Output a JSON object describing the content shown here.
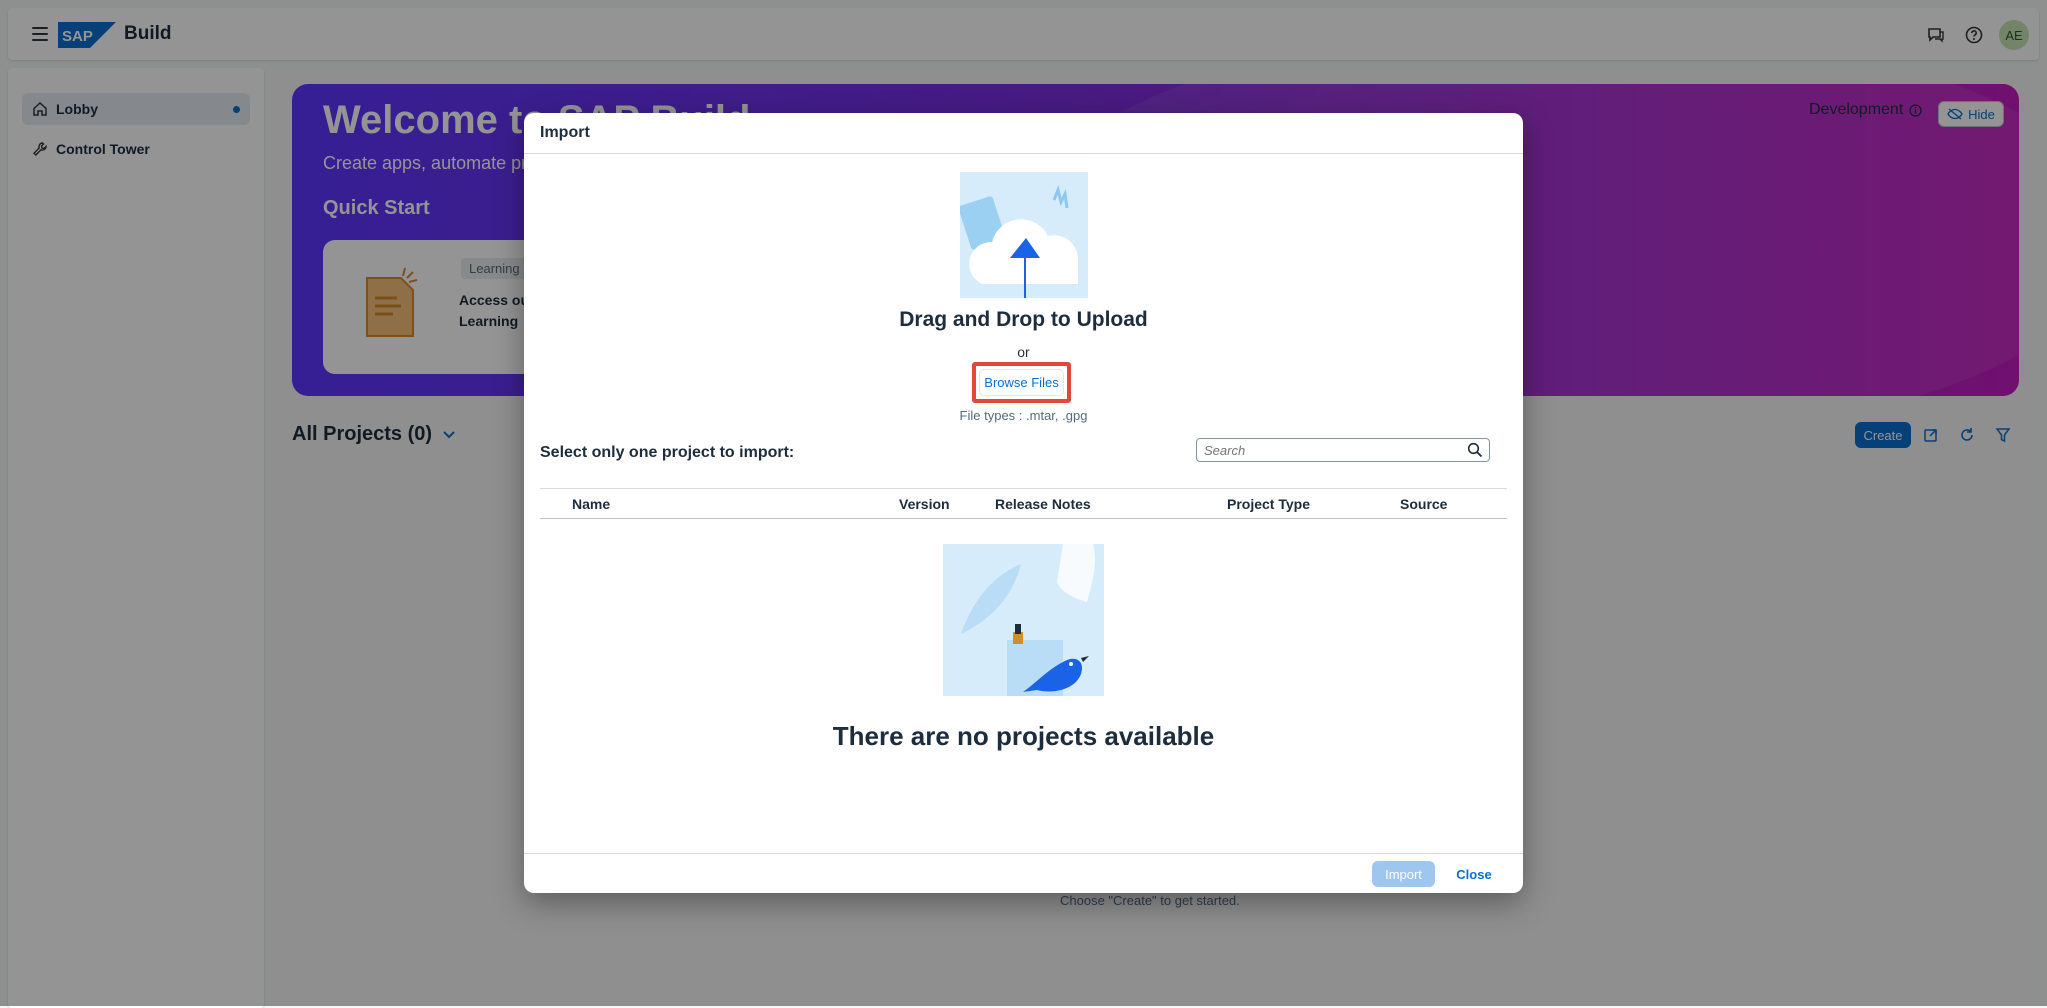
{
  "shell": {
    "logo_text": "SAP",
    "product": "Build",
    "avatar_initials": "AE",
    "icons": [
      "feedback-icon",
      "help-icon"
    ]
  },
  "sidebar": {
    "items": [
      {
        "label": "Lobby",
        "icon": "home-icon",
        "active": true
      },
      {
        "label": "Control Tower",
        "icon": "wrench-icon",
        "active": false
      }
    ]
  },
  "hero": {
    "title": "Welcome to SAP Build",
    "subtitle": "Create apps, automate processes",
    "quick_start": "Quick Start",
    "card_tag": "Learning",
    "card_text_1": "Access our",
    "card_text_2": "Learning",
    "environment": "Development",
    "hide_label": "Hide"
  },
  "projects": {
    "title": "All Projects (0)",
    "create_label": "Create",
    "hint": "Choose \"Create\" to get started."
  },
  "dialog": {
    "title": "Import",
    "drag_text": "Drag and Drop to Upload",
    "or_text": "or",
    "browse_label": "Browse Files",
    "file_types": "File types : .mtar, .gpg",
    "select_label": "Select only one project to import:",
    "search_placeholder": "Search",
    "columns": [
      "Name",
      "Version",
      "Release Notes",
      "Project Type",
      "Source"
    ],
    "empty_text": "There are no projects available",
    "import_label": "Import",
    "close_label": "Close"
  },
  "colors": {
    "accent": "#0a6ed1",
    "highlight": "#e2463d",
    "hero_start": "#5d36ff",
    "hero_end": "#c21dc0"
  }
}
